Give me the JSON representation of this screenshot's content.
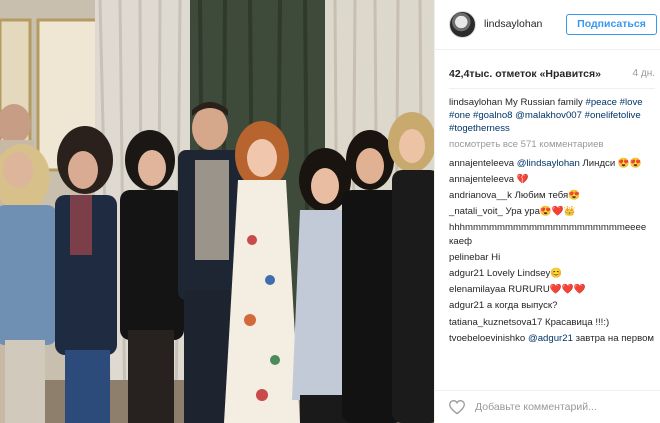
{
  "post": {
    "username": "lindsaylohan",
    "follow_label": "Подписаться",
    "likes": "42,4тыс. отметок «Нравится»",
    "time_ago": "4 дн.",
    "caption": {
      "author": "lindsaylohan",
      "text": " My Russian family ",
      "tags": [
        "#peace",
        "#love",
        "#one",
        "#goalno8",
        "@malakhov007",
        "#onelifetolive",
        "#togetherness"
      ]
    },
    "view_all": "посмотреть все 571 комментариев",
    "add_comment_placeholder": "Добавьте комментарий...",
    "photo_alt": "Group photo"
  },
  "comments": [
    {
      "user": "annajenteleeva",
      "mention": "@lindsaylohan",
      "text": " Линдси 😍😍"
    },
    {
      "user": "annajenteleeva",
      "mention": "",
      "text": " 💔"
    },
    {
      "user": "andrianova__k",
      "mention": "",
      "text": " Любим тебя😍"
    },
    {
      "user": "_natali_voit_",
      "mention": "",
      "text": " Ура ура😍❤️👑"
    },
    {
      "user": "hhhmmmmmmmmmmmmmmmmmmmmeeee",
      "mention": "",
      "text": " каеф"
    },
    {
      "user": "pelinebar",
      "mention": "",
      "text": " Hi"
    },
    {
      "user": "adgur21",
      "mention": "",
      "text": " Lovely Lindsey😊"
    },
    {
      "user": "elenamilayaa",
      "mention": "",
      "text": " RURURU❤️❤️❤️"
    },
    {
      "user": "adgur21",
      "mention": "",
      "text": " а когда выпуск?"
    },
    {
      "user": "tatiana_kuznetsova17",
      "mention": "",
      "text": " Красавица !!!:)"
    },
    {
      "user": "tvoebeloevinishko",
      "mention": "@adgur21",
      "text": " завтра на первом"
    }
  ],
  "colors": {
    "link": "#003569",
    "follow": "#3897f0",
    "muted": "#999999",
    "text": "#262626"
  },
  "icons": {
    "like": "heart-outline-icon",
    "avatar": "avatar"
  }
}
